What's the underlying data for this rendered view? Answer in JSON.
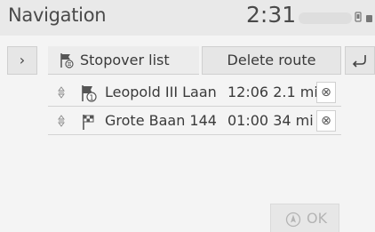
{
  "header": {
    "title": "Navigation",
    "clock": "2:31"
  },
  "side_tab": {
    "icon": "chevron-right-icon",
    "glyph": "›"
  },
  "stopover": {
    "label": "Stopover list",
    "icon": "stopover-list-icon"
  },
  "toolbar": {
    "delete_label": "Delete route",
    "back_icon": "back-arrow-icon"
  },
  "stops": [
    {
      "name": "Leopold III Laan",
      "time": "12:06",
      "distance": "2.1 mi",
      "flag": "waypoint-flag-icon",
      "flag_number": "1",
      "delete_glyph": "⊗"
    },
    {
      "name": "Grote Baan 144",
      "time": "01:00",
      "distance": "34 mi",
      "flag": "checkered-flag-icon",
      "delete_glyph": "⊗"
    }
  ],
  "ok_button": {
    "label": "OK",
    "icon": "navigation-icon"
  },
  "colors": {
    "background": "#f4f4f4",
    "header": "#e9e9e9",
    "button": "#e6e6e6",
    "disabled_text": "#b4b4b4"
  }
}
